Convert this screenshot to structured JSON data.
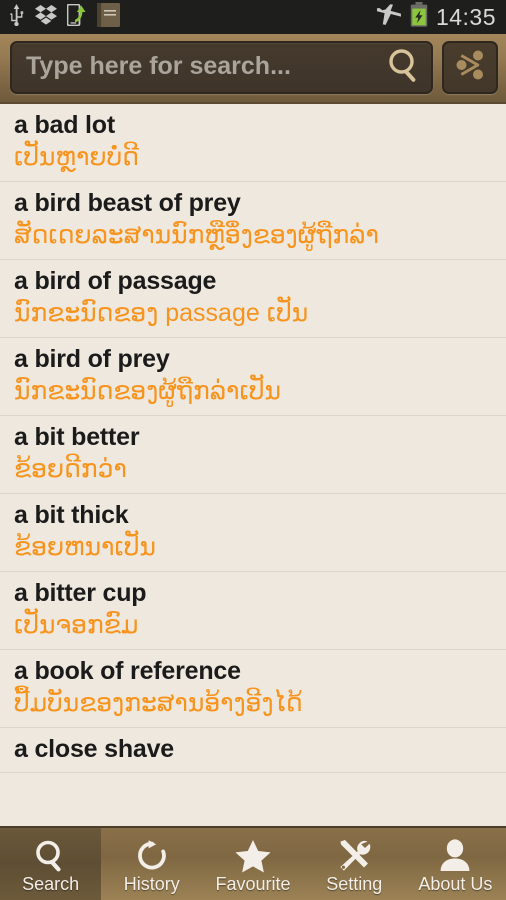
{
  "statusbar": {
    "time": "14:35",
    "left_icons": [
      "usb-icon",
      "dropbox-icon",
      "phone-upload-icon",
      "dictionary-book-icon"
    ],
    "right_icons": [
      "airplane-mode-icon",
      "battery-charging-icon"
    ],
    "battery_color": "#8CC63E",
    "background": "#1e1e1c"
  },
  "toolbar": {
    "search_placeholder": "Type here for search...",
    "search_value": "",
    "search_icon": "magnifier-icon",
    "share_icon": "share-icon",
    "accent": "#957a52"
  },
  "list": {
    "accent_translation_color": "#F7941E",
    "entries": [
      {
        "term": "a bad lot",
        "translation": "ເປັນຫຼາຍບໍ່ດີ"
      },
      {
        "term": "a bird beast of prey",
        "translation": "ສັດເດຍລະສານນົກຫຼືອຶ່ງຂອງຜູ້ຖືກລ່າ"
      },
      {
        "term": "a bird of passage",
        "translation": "ນົກຂະນົດຂອງ passage ເປັນ"
      },
      {
        "term": "a bird of prey",
        "translation": "ນົກຂະນົດຂອງຜູ້ຖືກລ່າເປັນ"
      },
      {
        "term": "a bit better",
        "translation": "ຂ້ອຍດີກວ່າ"
      },
      {
        "term": "a bit thick",
        "translation": "ຂ້ອຍຫນາເປັນ"
      },
      {
        "term": "a bitter cup",
        "translation": "ເປັນຈອກຂົມ"
      },
      {
        "term": "a book of reference",
        "translation": "ປື້ມບັນຂອງກະສານອ້າງອີງໄດ້"
      },
      {
        "term": "a close shave",
        "translation": ""
      }
    ]
  },
  "tabbar": {
    "active_index": 0,
    "tabs": [
      {
        "label": "Search",
        "icon": "search-icon"
      },
      {
        "label": "History",
        "icon": "history-refresh-icon"
      },
      {
        "label": "Favourite",
        "icon": "star-icon"
      },
      {
        "label": "Setting",
        "icon": "tools-icon"
      },
      {
        "label": "About Us",
        "icon": "person-icon"
      }
    ]
  }
}
